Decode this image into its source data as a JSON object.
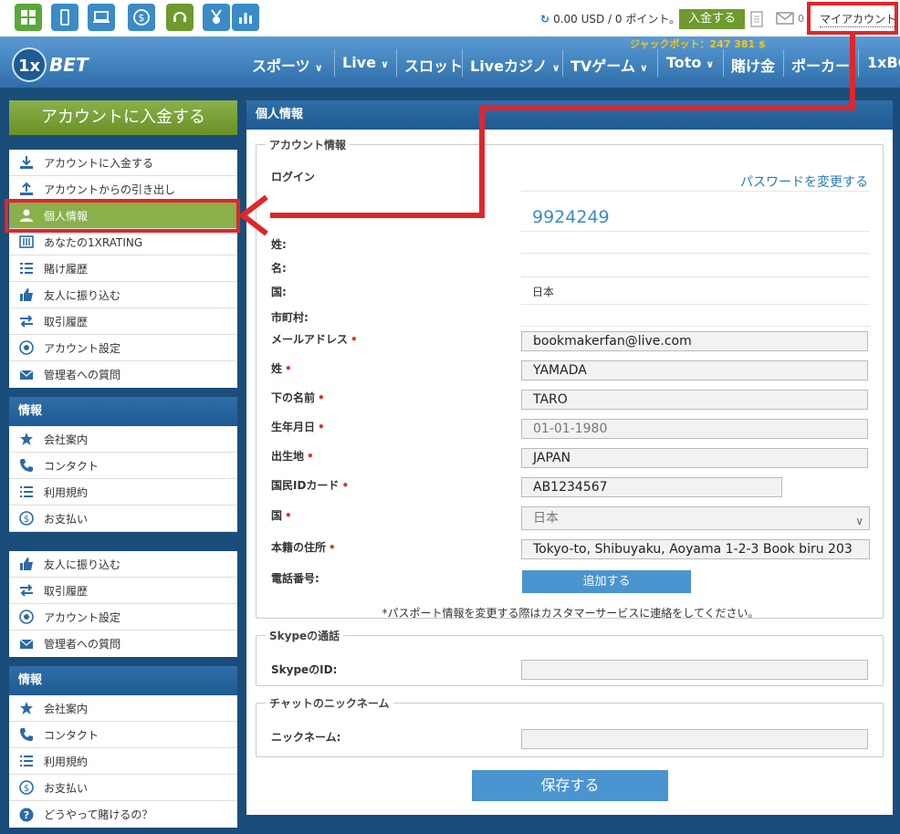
{
  "topbar": {
    "balance": "0.00 USD / 0 ポイント。",
    "deposit_label": "入金する",
    "mail_count": "0",
    "my_account": "マイアカウント"
  },
  "nav": {
    "jackpot": "ジャックポット：247 381 $",
    "items": [
      {
        "label": "スポーツ"
      },
      {
        "label": "Live"
      },
      {
        "label": "スロット"
      },
      {
        "label": "Liveカジノ"
      },
      {
        "label": "TVゲーム"
      },
      {
        "label": "Toto"
      },
      {
        "label": "賭け金"
      },
      {
        "label": "ポーカー"
      },
      {
        "label": "1xBC"
      }
    ]
  },
  "sidebar": {
    "deposit_big": "アカウントに入金する",
    "account_items": [
      {
        "label": "アカウントに入金する",
        "icon": "download-icon"
      },
      {
        "label": "アカウントからの引き出し",
        "icon": "upload-icon"
      },
      {
        "label": "個人情報",
        "icon": "user-icon"
      },
      {
        "label": "あなたの1XRATING",
        "icon": "rating-icon"
      },
      {
        "label": "賭け履歴",
        "icon": "list-icon"
      },
      {
        "label": "友人に振り込む",
        "icon": "thumb-icon"
      },
      {
        "label": "取引履歴",
        "icon": "transfer-icon"
      },
      {
        "label": "アカウント設定",
        "icon": "settings-icon"
      },
      {
        "label": "管理者への質問",
        "icon": "mail-icon"
      }
    ],
    "info_head_1": "情報",
    "info_items_1": [
      {
        "label": "会社案内",
        "icon": "star-icon"
      },
      {
        "label": "コンタクト",
        "icon": "phone-icon"
      },
      {
        "label": "利用規約",
        "icon": "terms-icon"
      },
      {
        "label": "お支払い",
        "icon": "dollar-icon"
      }
    ],
    "extra_items": [
      {
        "label": "友人に振り込む",
        "icon": "thumb-icon"
      },
      {
        "label": "取引履歴",
        "icon": "transfer-icon"
      },
      {
        "label": "アカウント設定",
        "icon": "settings-icon"
      },
      {
        "label": "管理者への質問",
        "icon": "mail-icon"
      }
    ],
    "info_head_2": "情報",
    "info_items_2": [
      {
        "label": "会社案内",
        "icon": "star-icon"
      },
      {
        "label": "コンタクト",
        "icon": "phone-icon"
      },
      {
        "label": "利用規約",
        "icon": "terms-icon"
      },
      {
        "label": "お支払い",
        "icon": "dollar-icon"
      },
      {
        "label": "どうやって賭けるの？",
        "icon": "question-icon"
      }
    ]
  },
  "main": {
    "title": "個人情報",
    "account_group": "アカウント情報",
    "login_label": "ログイン",
    "password_change": "パスワードを変更する",
    "account_number": "9924249",
    "labels": {
      "last_name": "姓:",
      "first_name": "名:",
      "country": "国:",
      "city": "市町村:",
      "email": "メールアドレス",
      "surname": "姓",
      "given_name": "下の名前",
      "birthdate": "生年月日",
      "birthplace": "出生地",
      "id_card": "国民IDカード",
      "country2": "国",
      "address": "本籍の住所",
      "phone": "電話番号:"
    },
    "values": {
      "country": "日本",
      "email": "bookmakerfan@live.com",
      "surname": "YAMADA",
      "given_name": "TARO",
      "birthdate": "01-01-1980",
      "birthplace": "JAPAN",
      "id_card": "AB1234567",
      "country2": "日本",
      "address": "Tokyo-to, Shibuyaku, Aoyama 1-2-3 Book biru 203"
    },
    "add_button": "追加する",
    "note": "*パスポート情報を変更する際はカスタマーサービスに連絡をしてください。",
    "skype_group": "Skypeの通話",
    "skype_label": "SkypeのID:",
    "chat_group": "チャットのニックネーム",
    "nickname_label": "ニックネーム:",
    "save_button": "保存する"
  }
}
